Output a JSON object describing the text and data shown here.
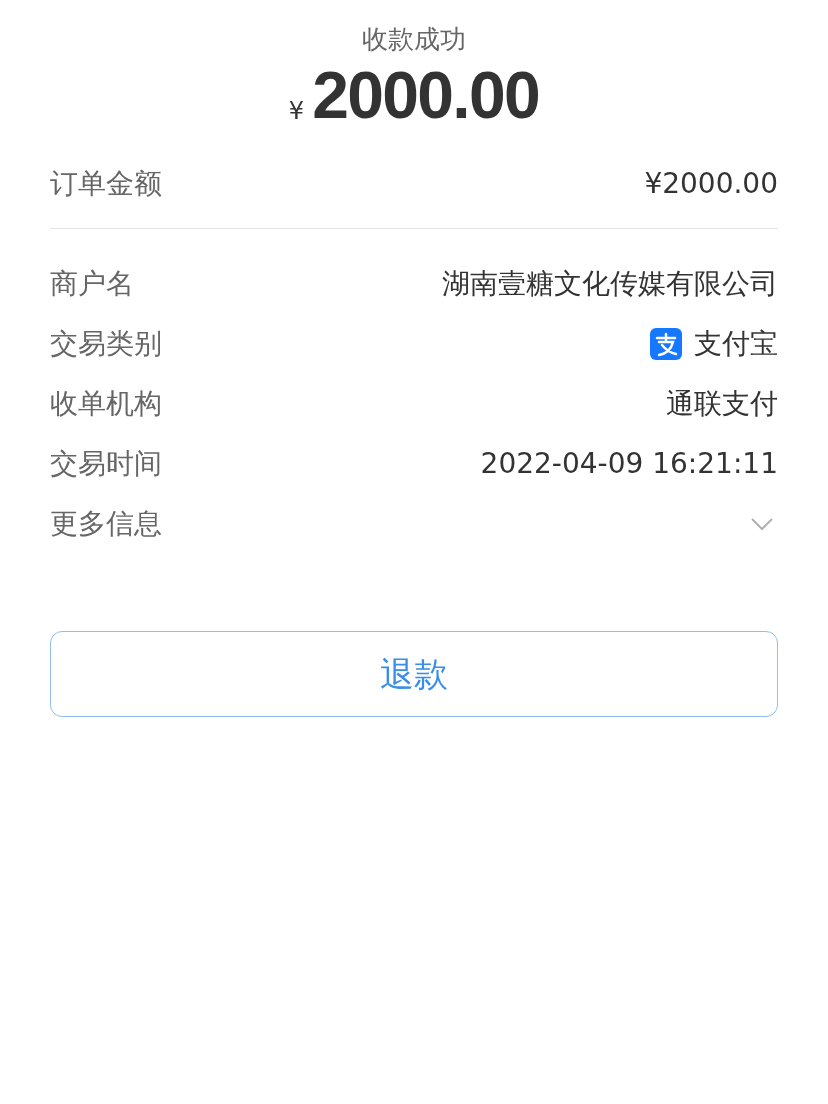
{
  "header": {
    "title": "收款成功",
    "currency": "¥",
    "amount": "2000.00"
  },
  "order": {
    "label": "订单金额",
    "value": "¥2000.00"
  },
  "details": [
    {
      "kind": "text",
      "label": "商户名",
      "value": "湖南壹糖文化传媒有限公司"
    },
    {
      "kind": "payment",
      "label": "交易类别",
      "value": "支付宝"
    },
    {
      "kind": "text",
      "label": "收单机构",
      "value": "通联支付"
    },
    {
      "kind": "text",
      "label": "交易时间",
      "value": "2022-04-09 16:21:11"
    },
    {
      "kind": "expander",
      "label": "更多信息",
      "expanded": false
    }
  ],
  "refund_button": "退款"
}
